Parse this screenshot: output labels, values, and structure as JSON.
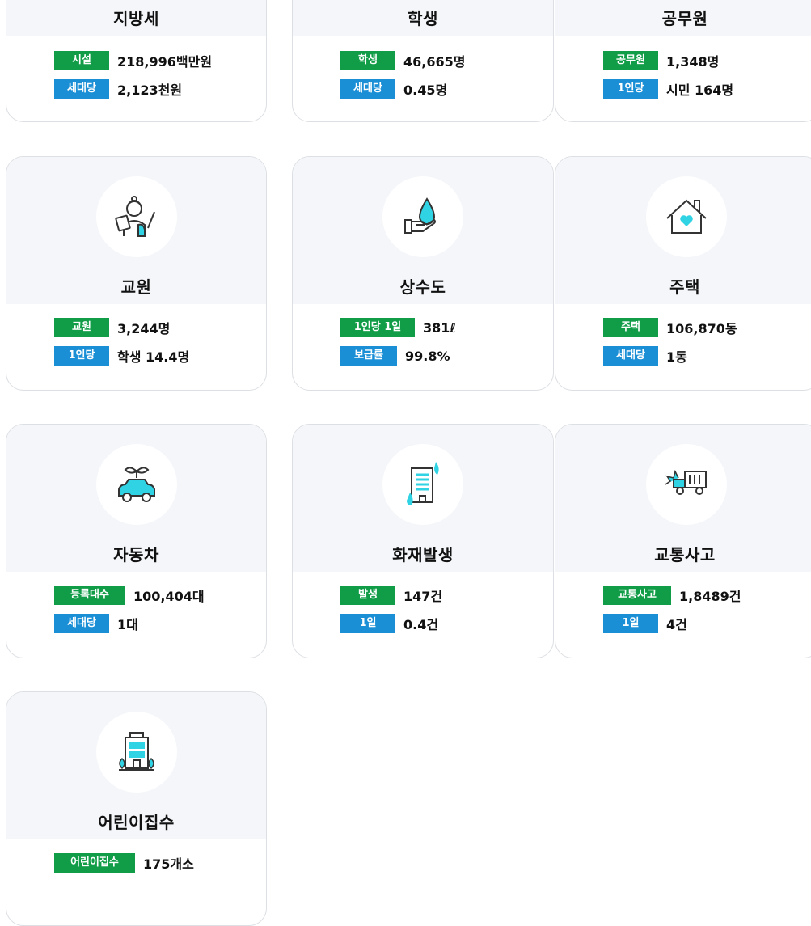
{
  "colors": {
    "green_badge": "#119d48",
    "blue_badge": "#1b8fd6",
    "icon_accent": "#2fd3e3"
  },
  "cards": {
    "local_tax": {
      "title": "지방세",
      "row1": {
        "label": "시설",
        "value": "218,996백만원"
      },
      "row2": {
        "label": "세대당",
        "value": "2,123천원"
      }
    },
    "students": {
      "title": "학생",
      "row1": {
        "label": "학생",
        "value": "46,665명"
      },
      "row2": {
        "label": "세대당",
        "value": "0.45명"
      }
    },
    "officials": {
      "title": "공무원",
      "row1": {
        "label": "공무원",
        "value": "1,348명"
      },
      "row2": {
        "label": "1인당",
        "value": "시민 164명"
      }
    },
    "teachers": {
      "title": "교원",
      "icon": "teacher-icon",
      "row1": {
        "label": "교원",
        "value": "3,244명"
      },
      "row2": {
        "label": "1인당",
        "value": "학생 14.4명"
      }
    },
    "water": {
      "title": "상수도",
      "icon": "water-hand-icon",
      "row1": {
        "label": "1인당 1일",
        "value": "381ℓ"
      },
      "row2": {
        "label": "보급률",
        "value": "99.8%"
      }
    },
    "housing": {
      "title": "주택",
      "icon": "house-heart-icon",
      "row1": {
        "label": "주택",
        "value": "106,870동"
      },
      "row2": {
        "label": "세대당",
        "value": "1동"
      }
    },
    "cars": {
      "title": "자동차",
      "icon": "eco-car-icon",
      "row1": {
        "label": "등록대수",
        "value": "100,404대"
      },
      "row2": {
        "label": "세대당",
        "value": "1대"
      }
    },
    "fire": {
      "title": "화재발생",
      "icon": "burning-building-icon",
      "row1": {
        "label": "발생",
        "value": "147건"
      },
      "row2": {
        "label": "1일",
        "value": "0.4건"
      }
    },
    "accidents": {
      "title": "교통사고",
      "icon": "truck-crash-icon",
      "row1": {
        "label": "교통사고",
        "value": "1,8489건"
      },
      "row2": {
        "label": "1일",
        "value": "4건"
      }
    },
    "daycare": {
      "title": "어린이집수",
      "icon": "daycare-building-icon",
      "row1": {
        "label": "어린이집수",
        "value": "175개소"
      }
    }
  }
}
